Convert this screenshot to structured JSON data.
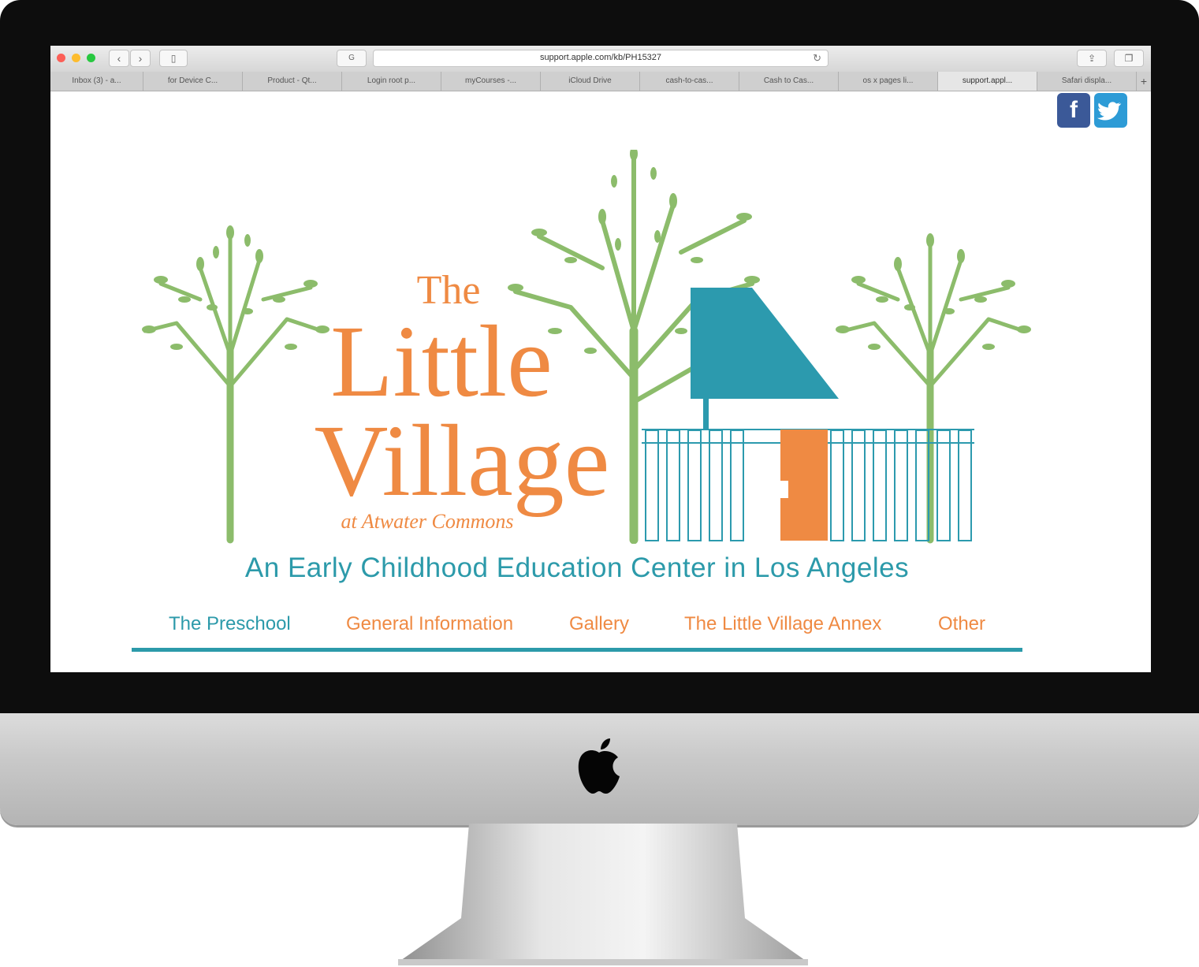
{
  "browser": {
    "url": "support.apple.com/kb/PH15327",
    "tabs": [
      {
        "label": "Inbox (3) - a..."
      },
      {
        "label": "for Device C..."
      },
      {
        "label": "Product - Qt..."
      },
      {
        "label": "Login root p..."
      },
      {
        "label": "myCourses -..."
      },
      {
        "label": "iCloud Drive"
      },
      {
        "label": "cash-to-cas..."
      },
      {
        "label": "Cash to Cas..."
      },
      {
        "label": "os x pages li..."
      },
      {
        "label": "support.appl..."
      },
      {
        "label": "Safari displa..."
      }
    ],
    "active_tab_index": 9,
    "icons": [
      "close-light-icon",
      "minimize-light-icon",
      "zoom-light-icon",
      "back-icon",
      "forward-icon",
      "sidebar-icon",
      "shield-icon",
      "reload-icon",
      "share-icon",
      "tabs-overview-icon",
      "new-tab-icon"
    ]
  },
  "page": {
    "logo": {
      "line1": "The",
      "line2": "Little",
      "line3": "Village",
      "line4": "at Atwater Commons"
    },
    "tagline": "An Early Childhood Education Center in Los Angeles",
    "nav": [
      {
        "label": "The Preschool",
        "color": "#2c9aaa"
      },
      {
        "label": "General Information",
        "color": "#ef8a43"
      },
      {
        "label": "Gallery",
        "color": "#ef8a43"
      },
      {
        "label": "The Little Village Annex",
        "color": "#ef8a43"
      },
      {
        "label": "Other",
        "color": "#ef8a43"
      }
    ],
    "social": {
      "facebook": "f",
      "facebook_color": "#3b5998",
      "twitter_color": "#2d9bd6"
    }
  },
  "colors": {
    "teal": "#2c9aaa",
    "orange": "#ef8a43",
    "tree_green": "#8cbc6b",
    "roof_teal": "#2c9aae"
  }
}
